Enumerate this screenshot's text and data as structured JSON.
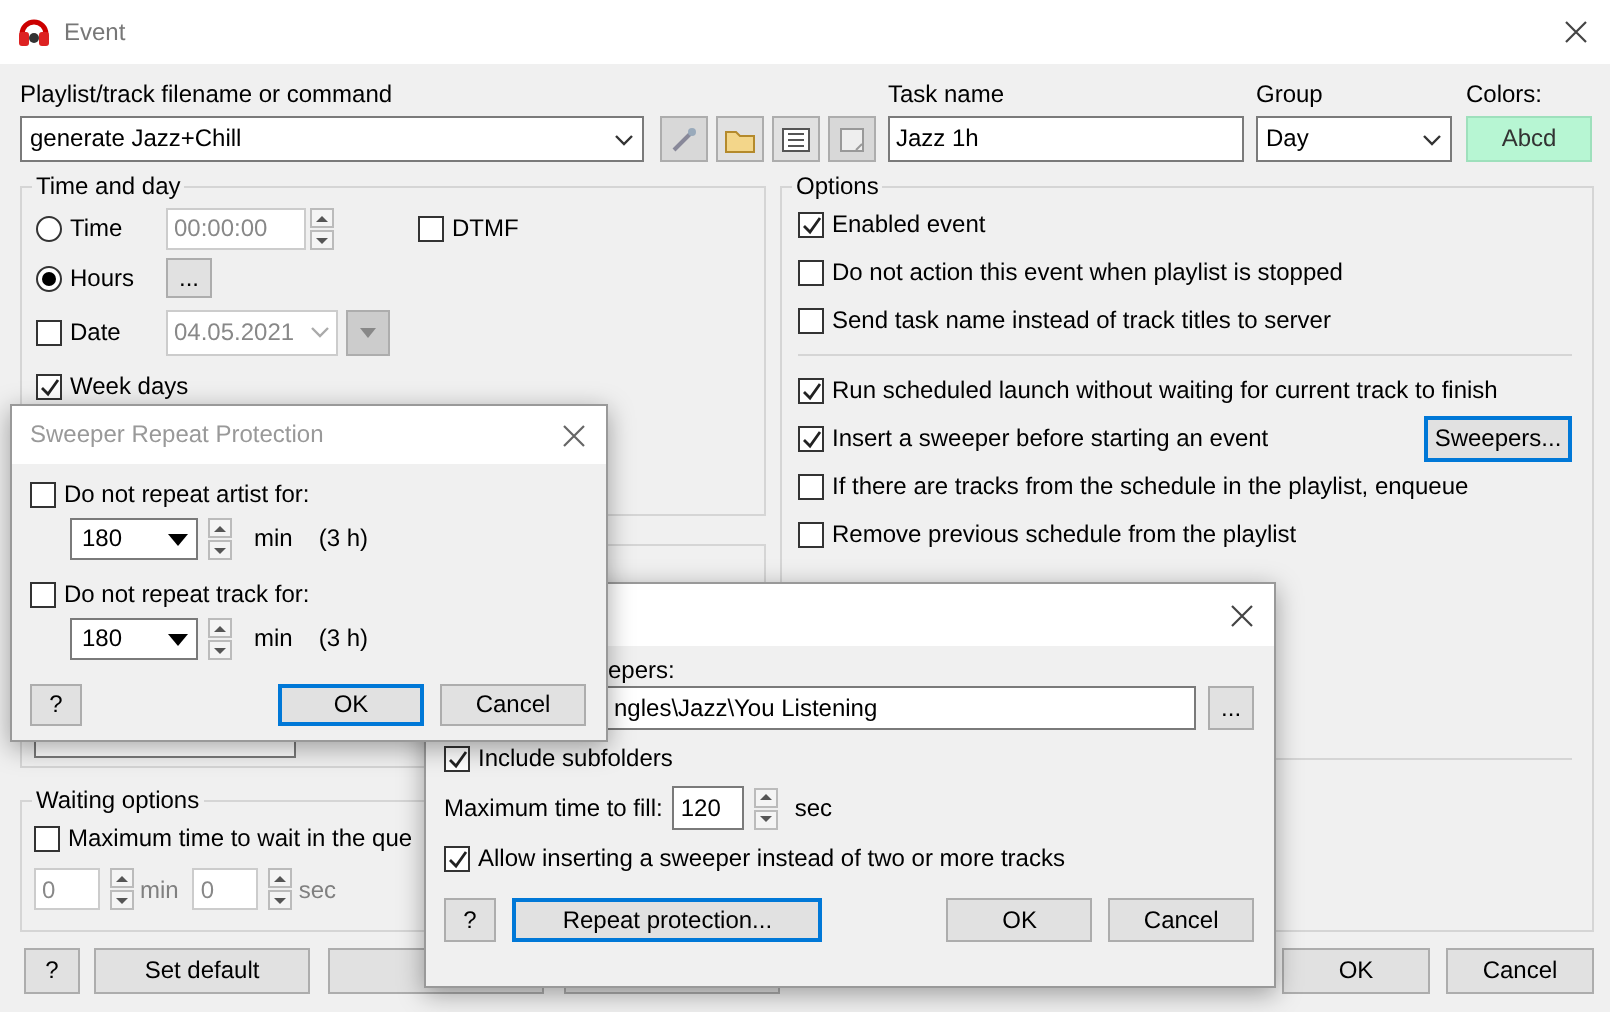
{
  "window": {
    "title": "Event"
  },
  "command": {
    "label": "Playlist/track filename or command",
    "value": "generate Jazz+Chill"
  },
  "task_name": {
    "label": "Task name",
    "value": "Jazz 1h"
  },
  "group": {
    "label": "Group",
    "value": "Day"
  },
  "colors": {
    "label": "Colors:",
    "sample": "Abcd"
  },
  "time_and_day": {
    "title": "Time and day",
    "modes": [
      {
        "label": "Time",
        "selected": false,
        "value": "00:00:00"
      },
      {
        "label": "Hours",
        "selected": true,
        "button": "..."
      }
    ],
    "dtmf": {
      "label": "DTMF",
      "checked": false
    },
    "date": {
      "label": "Date",
      "checked": false,
      "value": "04.05.2021"
    },
    "week_days": {
      "label": "Week days",
      "checked": true
    }
  },
  "waiting": {
    "title": "Waiting options",
    "max_wait": {
      "label": "Maximum time to wait in the que",
      "checked": false
    },
    "minutes": "0",
    "min_unit": "min",
    "seconds": "0",
    "sec_unit": "sec"
  },
  "options": {
    "title": "Options",
    "items": [
      {
        "label": "Enabled event",
        "checked": true
      },
      {
        "label": "Do not action this event when playlist is stopped",
        "checked": false
      },
      {
        "label": "Send task name instead of track titles to server",
        "checked": false
      }
    ],
    "launch_items": [
      {
        "label": "Run scheduled launch without waiting for current track to finish",
        "checked": true
      },
      {
        "label": "Insert a sweeper before starting an event",
        "checked": true,
        "button": {
          "label": "Sweepers...",
          "focused": true
        }
      },
      {
        "label": "If there are tracks from the schedule in the playlist, enqueue",
        "checked": false
      },
      {
        "label": "Remove previous schedule from the playlist",
        "checked": false
      }
    ]
  },
  "footer": {
    "left_buttons": [
      "?",
      "Set default"
    ],
    "right_buttons": [
      "OK",
      "Cancel"
    ]
  },
  "sweepers_dialog": {
    "folder_label": "epers:",
    "folder": "ngles\\Jazz\\You Listening",
    "browse": "...",
    "include_subfolders": {
      "label": "Include subfolders",
      "checked": true
    },
    "max_fill": {
      "label": "Maximum time to fill:",
      "value": "120",
      "unit": "sec"
    },
    "allow_multi": {
      "label": "Allow inserting a sweeper instead of two or more tracks",
      "checked": true
    },
    "buttons": [
      {
        "label": "?",
        "focused": false
      },
      {
        "label": "Repeat protection...",
        "focused": true
      },
      {
        "label": "OK",
        "focused": false
      },
      {
        "label": "Cancel",
        "focused": false
      }
    ]
  },
  "repeat_dialog": {
    "title": "Sweeper Repeat Protection",
    "rules": [
      {
        "label": "Do not repeat artist for:",
        "checked": false,
        "value": "180",
        "unit": "min",
        "hint": "(3 h)"
      },
      {
        "label": "Do not repeat track for:",
        "checked": false,
        "value": "180",
        "unit": "min",
        "hint": "(3 h)"
      }
    ],
    "buttons": [
      {
        "label": "?",
        "focused": false
      },
      {
        "label": "OK",
        "focused": true
      },
      {
        "label": "Cancel",
        "focused": false
      }
    ]
  }
}
